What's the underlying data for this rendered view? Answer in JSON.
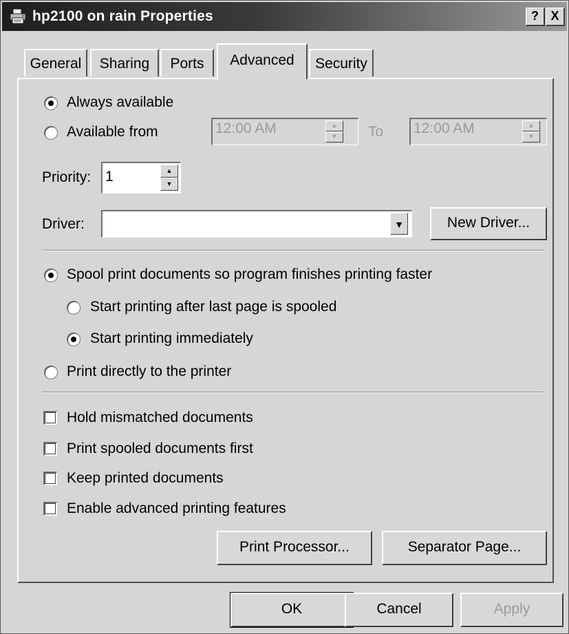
{
  "window": {
    "title": "hp2100 on rain Properties"
  },
  "titlebar_buttons": {
    "help": "?",
    "close": "X"
  },
  "tabs": [
    {
      "label": "General"
    },
    {
      "label": "Sharing"
    },
    {
      "label": "Ports"
    },
    {
      "label": "Advanced",
      "active": true
    },
    {
      "label": "Security"
    }
  ],
  "availability": {
    "always_label": "Always available",
    "always_selected": true,
    "from_label": "Available from",
    "from_selected": false,
    "from_time": "12:00 AM",
    "to_label": "To",
    "to_time": "12:00 AM"
  },
  "priority": {
    "label": "Priority:",
    "value": "1"
  },
  "driver": {
    "label": "Driver:",
    "value": "",
    "new_driver_button": "New Driver..."
  },
  "spool": {
    "spool_label": "Spool print documents so program finishes printing faster",
    "spool_selected": true,
    "after_last_label": "Start printing after last page is spooled",
    "after_last_selected": false,
    "immediately_label": "Start printing immediately",
    "immediately_selected": true,
    "direct_label": "Print directly to the printer",
    "direct_selected": false
  },
  "options": [
    {
      "label": "Hold mismatched documents",
      "checked": false
    },
    {
      "label": "Print spooled documents first",
      "checked": false
    },
    {
      "label": "Keep printed documents",
      "checked": false
    },
    {
      "label": "Enable advanced printing features",
      "checked": false
    }
  ],
  "panel_buttons": {
    "print_processor": "Print Processor...",
    "separator_page": "Separator Page..."
  },
  "dialog_buttons": {
    "ok": "OK",
    "cancel": "Cancel",
    "apply": "Apply"
  },
  "icons": {
    "title": "printer-icon",
    "spin_up": "▲",
    "spin_down": "▼",
    "dropdown": "▼"
  }
}
